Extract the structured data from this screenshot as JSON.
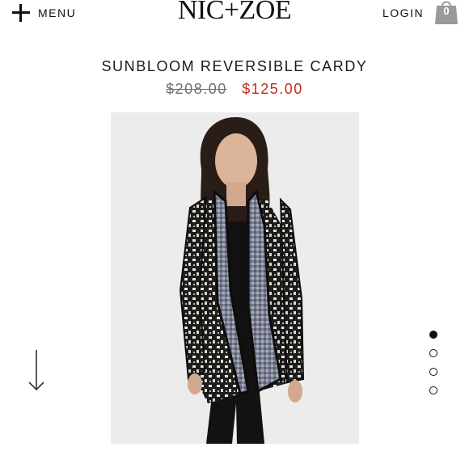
{
  "header": {
    "menu_label": "MENU",
    "logo_text": "NIC+ZOE",
    "login_label": "LOGIN",
    "cart_count": "0"
  },
  "product": {
    "title": "SUNBLOOM REVERSIBLE CARDY",
    "original_price": "$208.00",
    "sale_price": "$125.00",
    "image_icon": "model-wearing-cardigan-photo"
  },
  "gallery": {
    "active_index": 0,
    "total": 4
  },
  "colors": {
    "sale": "#c8261f",
    "original": "#6f6f6f",
    "bag": "#9a9a9a"
  }
}
